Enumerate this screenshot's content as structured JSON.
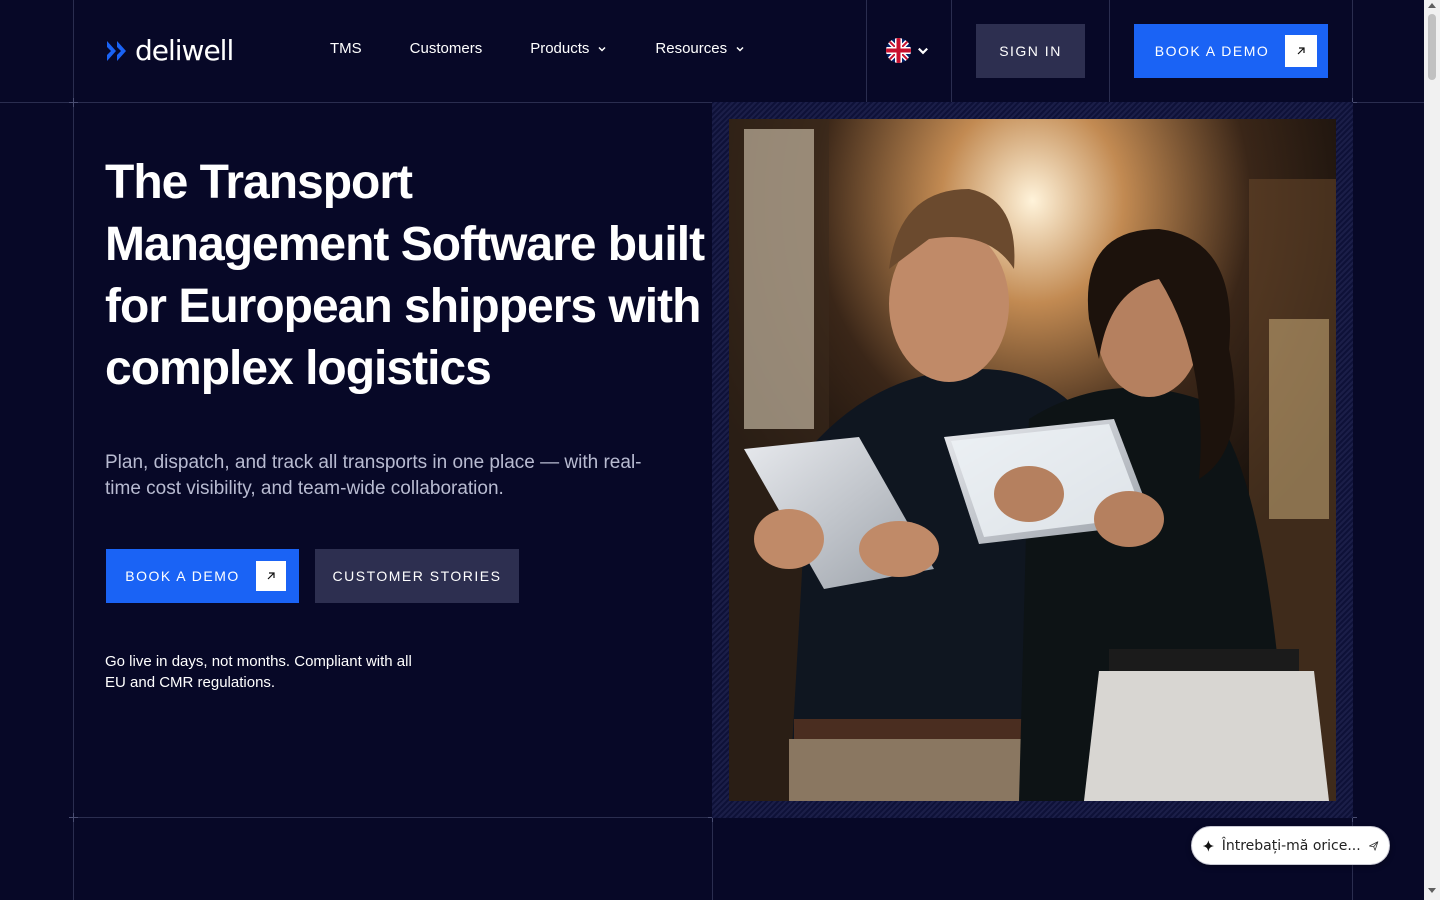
{
  "brand": {
    "name": "deliwell",
    "accent": "#1a63f5",
    "background": "#070827"
  },
  "nav": {
    "items": [
      {
        "label": "TMS",
        "has_dropdown": false
      },
      {
        "label": "Customers",
        "has_dropdown": false
      },
      {
        "label": "Products",
        "has_dropdown": true
      },
      {
        "label": "Resources",
        "has_dropdown": true
      }
    ],
    "language_icon": "uk-flag-icon"
  },
  "header": {
    "sign_in_label": "SIGN IN",
    "book_demo_label": "BOOK A DEMO"
  },
  "hero": {
    "headline": "The Transport Management Software built for European shippers with complex logistics",
    "subheadline": "Plan, dispatch, and track all transports in one place — with real-time cost visibility, and team-wide collaboration.",
    "cta_primary": "BOOK A DEMO",
    "cta_secondary": "CUSTOMER STORIES",
    "note": "Go live in days, not months. Compliant with all EU and CMR regulations."
  },
  "chat_widget": {
    "placeholder": "Întrebați-mă orice...",
    "icon": "sparkle-icon",
    "send_icon": "send-icon"
  }
}
